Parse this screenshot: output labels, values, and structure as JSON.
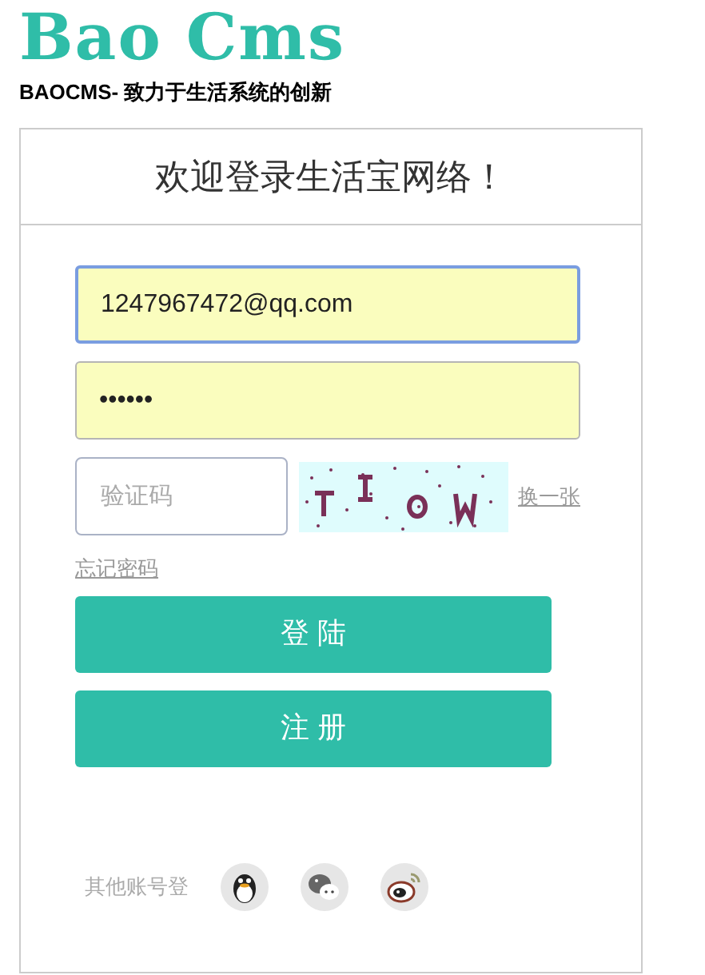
{
  "logo": {
    "title": "Bao Cms",
    "tagline": "BAOCMS- 致力于生活系统的创新"
  },
  "card": {
    "title": "欢迎登录生活宝网络！"
  },
  "form": {
    "username": {
      "value": "1247967472@qq.com",
      "focused": true
    },
    "password": {
      "value": "••••••"
    },
    "captcha": {
      "placeholder": "验证码",
      "refresh": "换一张"
    },
    "forgot": "忘记密码",
    "buttons": [
      {
        "label": "登 陆"
      },
      {
        "label": "注 册"
      }
    ]
  },
  "social": {
    "label": "其他账号登",
    "items": [
      {
        "kind": "qq"
      },
      {
        "kind": "wechat"
      },
      {
        "kind": "weibo"
      }
    ]
  }
}
